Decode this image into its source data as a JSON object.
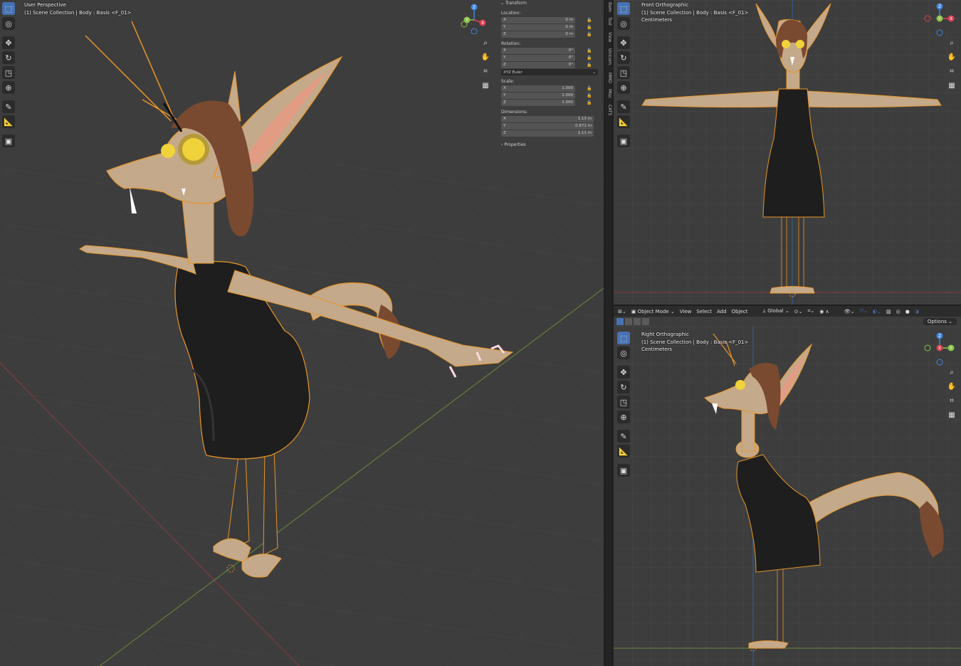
{
  "viewports": {
    "main": {
      "title": "User Perspective",
      "collection": "(1) Scene Collection | Body : Basis <F_01>"
    },
    "front": {
      "title": "Front Orthographic",
      "collection": "(1) Scene Collection | Body : Basis <F_01>",
      "units": "Centimeters"
    },
    "right": {
      "title": "Right Orthographic",
      "collection": "(1) Scene Collection | Body : Basis <F_01>",
      "units": "Centimeters"
    }
  },
  "gizmo_axes": {
    "x": "X",
    "y": "Y",
    "z": "Z"
  },
  "npanel": {
    "header": "Transform",
    "location_label": "Location:",
    "location": [
      {
        "axis": "X",
        "value": "0 m"
      },
      {
        "axis": "Y",
        "value": "0 m"
      },
      {
        "axis": "Z",
        "value": "0 m"
      }
    ],
    "rotation_label": "Rotation:",
    "rotation": [
      {
        "axis": "X",
        "value": "0°"
      },
      {
        "axis": "Y",
        "value": "0°"
      },
      {
        "axis": "Z",
        "value": "0°"
      }
    ],
    "rotation_mode": "XYZ Euler",
    "scale_label": "Scale:",
    "scale": [
      {
        "axis": "X",
        "value": "1.000"
      },
      {
        "axis": "Y",
        "value": "1.000"
      },
      {
        "axis": "Z",
        "value": "1.000"
      }
    ],
    "dimensions_label": "Dimensions:",
    "dimensions": [
      {
        "axis": "X",
        "value": "1.13 m"
      },
      {
        "axis": "Y",
        "value": "0.871 m"
      },
      {
        "axis": "Z",
        "value": "1.11 m"
      }
    ],
    "properties": "Properties"
  },
  "sidebar_tabs": [
    "Item",
    "Tool",
    "View",
    "Unicorn",
    "MMD",
    "Misc",
    "CATS"
  ],
  "header": {
    "mode": "Object Mode",
    "menus": [
      "View",
      "Select",
      "Add",
      "Object"
    ],
    "orientation": "Global",
    "options": "Options"
  },
  "colors": {
    "accent": "#4772b3",
    "outline": "#e8962a",
    "x_axis": "#e04050",
    "y_axis": "#8bc34a",
    "z_axis": "#3d86e0",
    "viewport_bg": "#3d3d3d"
  }
}
